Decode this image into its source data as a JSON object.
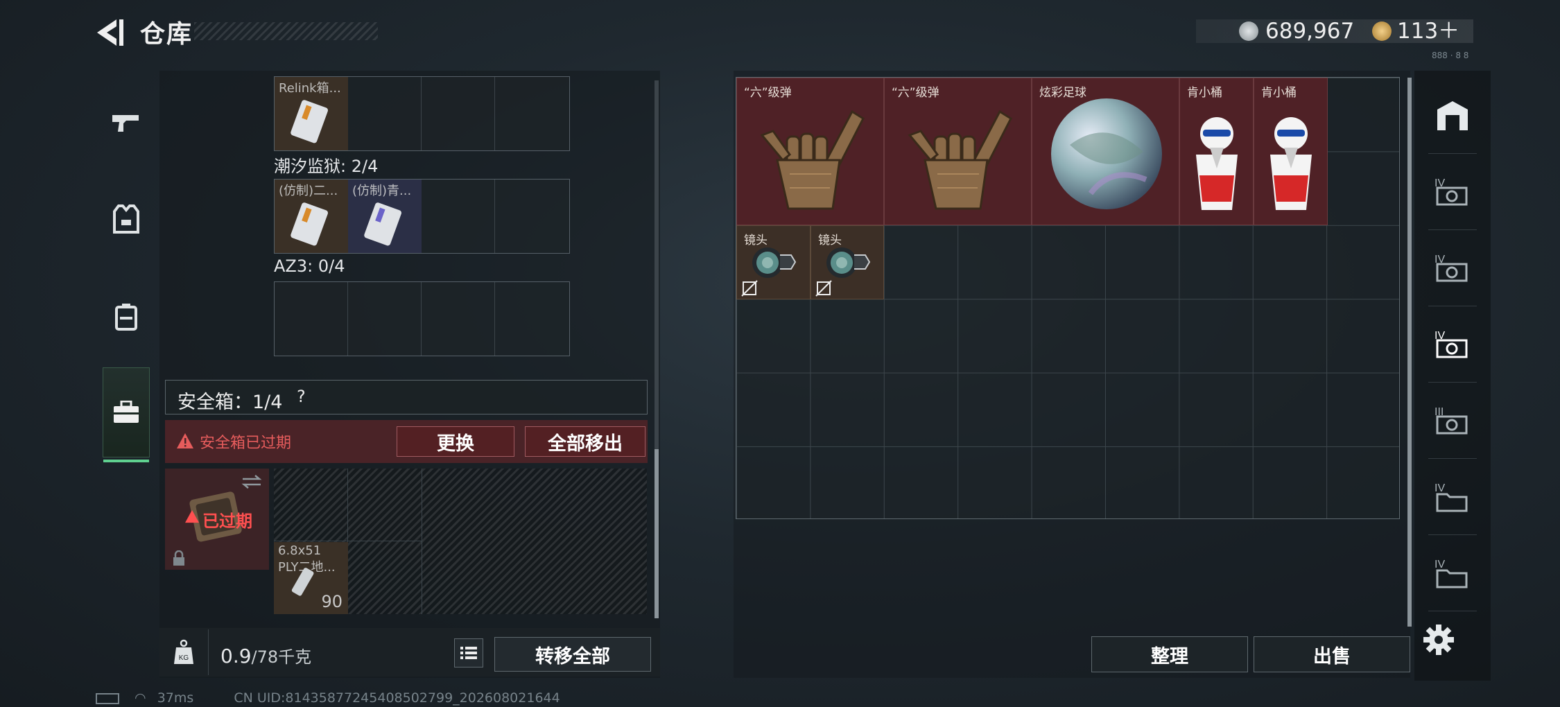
{
  "header": {
    "title": "仓库",
    "currency": [
      {
        "icon": "silver-coin-icon",
        "value": "689,967"
      },
      {
        "icon": "gold-coin-icon",
        "value": "113＋"
      }
    ],
    "serial": "888 · 8 8"
  },
  "left_nav": [
    {
      "icon": "pistol-icon"
    },
    {
      "icon": "armor-vest-icon"
    },
    {
      "icon": "backpack-icon"
    },
    {
      "icon": "briefcase-icon",
      "active": true
    }
  ],
  "left_panel": {
    "top_items": [
      {
        "label": "Relink箱..."
      }
    ],
    "sections": [
      {
        "label": "潮汐监狱: 2/4",
        "items": [
          {
            "label": "(仿制)二..."
          },
          {
            "label": "(仿制)青..."
          }
        ]
      },
      {
        "label": "AZ3: 0/4",
        "items": []
      }
    ],
    "safe_box": {
      "label": "安全箱：1/4",
      "help": "?",
      "expired_text": "安全箱已过期",
      "replace_label": "更换",
      "move_all_label": "全部移出",
      "expired_tag": "已过期"
    },
    "ammo": {
      "label": "6.8x51",
      "sublabel": "PLY二地...",
      "count": "90"
    },
    "weight": {
      "value": "0.9",
      "max": "/78千克"
    },
    "transfer_all_label": "转移全部"
  },
  "stash": {
    "items": [
      {
        "label": "“六”级弹",
        "type": "hand"
      },
      {
        "label": "“六”级弹",
        "type": "hand"
      },
      {
        "label": "炫彩足球",
        "type": "ball"
      },
      {
        "label": "肯小桶",
        "type": "bucket"
      },
      {
        "label": "肯小桶",
        "type": "bucket"
      },
      {
        "label": "镜头",
        "type": "lens"
      },
      {
        "label": "镜头",
        "type": "lens"
      }
    ]
  },
  "right_nav": [
    {
      "icon": "container-icon"
    },
    {
      "icon": "stash-case-4a-icon",
      "label": "IV"
    },
    {
      "icon": "stash-case-4b-icon",
      "label": "IV"
    },
    {
      "icon": "stash-case-4c-icon",
      "label": "IV",
      "active": true
    },
    {
      "icon": "stash-case-3-icon",
      "label": "III"
    },
    {
      "icon": "folder-4a-icon",
      "label": "IV"
    },
    {
      "icon": "folder-4b-icon",
      "label": "IV"
    }
  ],
  "actions": {
    "sort_label": "整理",
    "sell_label": "出售"
  },
  "status_bar": {
    "ping": "37ms",
    "uid": "CN UID:81435877245408502799_202608021644"
  },
  "colors": {
    "accent_green": "#5fd08f",
    "danger_red": "#e65c5c",
    "item_red": "#4f2126"
  }
}
